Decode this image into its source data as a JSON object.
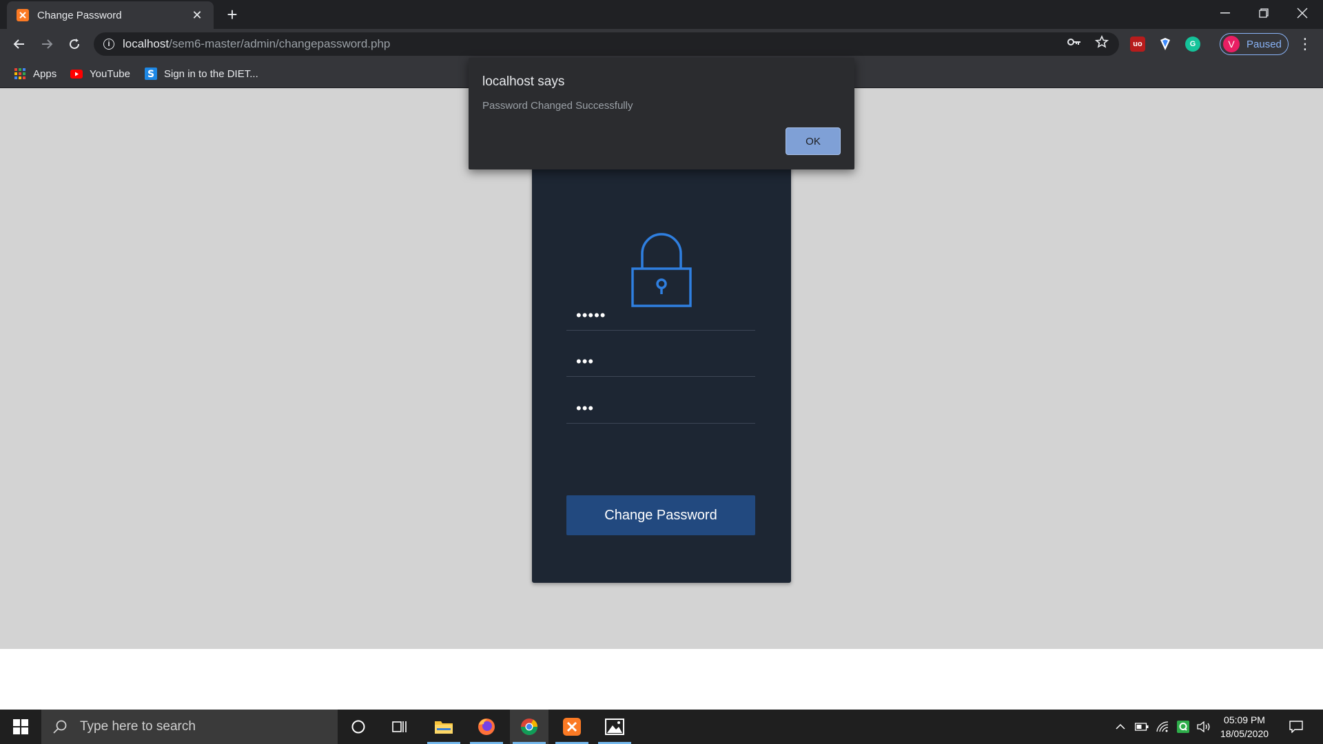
{
  "browser": {
    "tab_title": "Change Password",
    "url_host": "localhost",
    "url_path": "/sem6-master/admin/changepassword.php",
    "profile_initial": "V",
    "profile_status": "Paused",
    "bookmarks": [
      {
        "label": "Apps"
      },
      {
        "label": "YouTube"
      },
      {
        "label": "Sign in to the DIET..."
      }
    ]
  },
  "dialog": {
    "title": "localhost says",
    "message": "Password Changed Successfully",
    "ok_label": "OK"
  },
  "form": {
    "fields": [
      {
        "masked_value": "•••••"
      },
      {
        "masked_value": "•••"
      },
      {
        "masked_value": "•••"
      }
    ],
    "submit_label": "Change Password"
  },
  "taskbar": {
    "search_placeholder": "Type here to search",
    "time": "05:09 PM",
    "date": "18/05/2020"
  },
  "colors": {
    "page_bg": "#d3d3d3",
    "card_bg": "#1d2633",
    "accent_blue": "#2f7fe0",
    "button_bg": "#22497f",
    "dialog_ok": "#7fa0d6"
  }
}
